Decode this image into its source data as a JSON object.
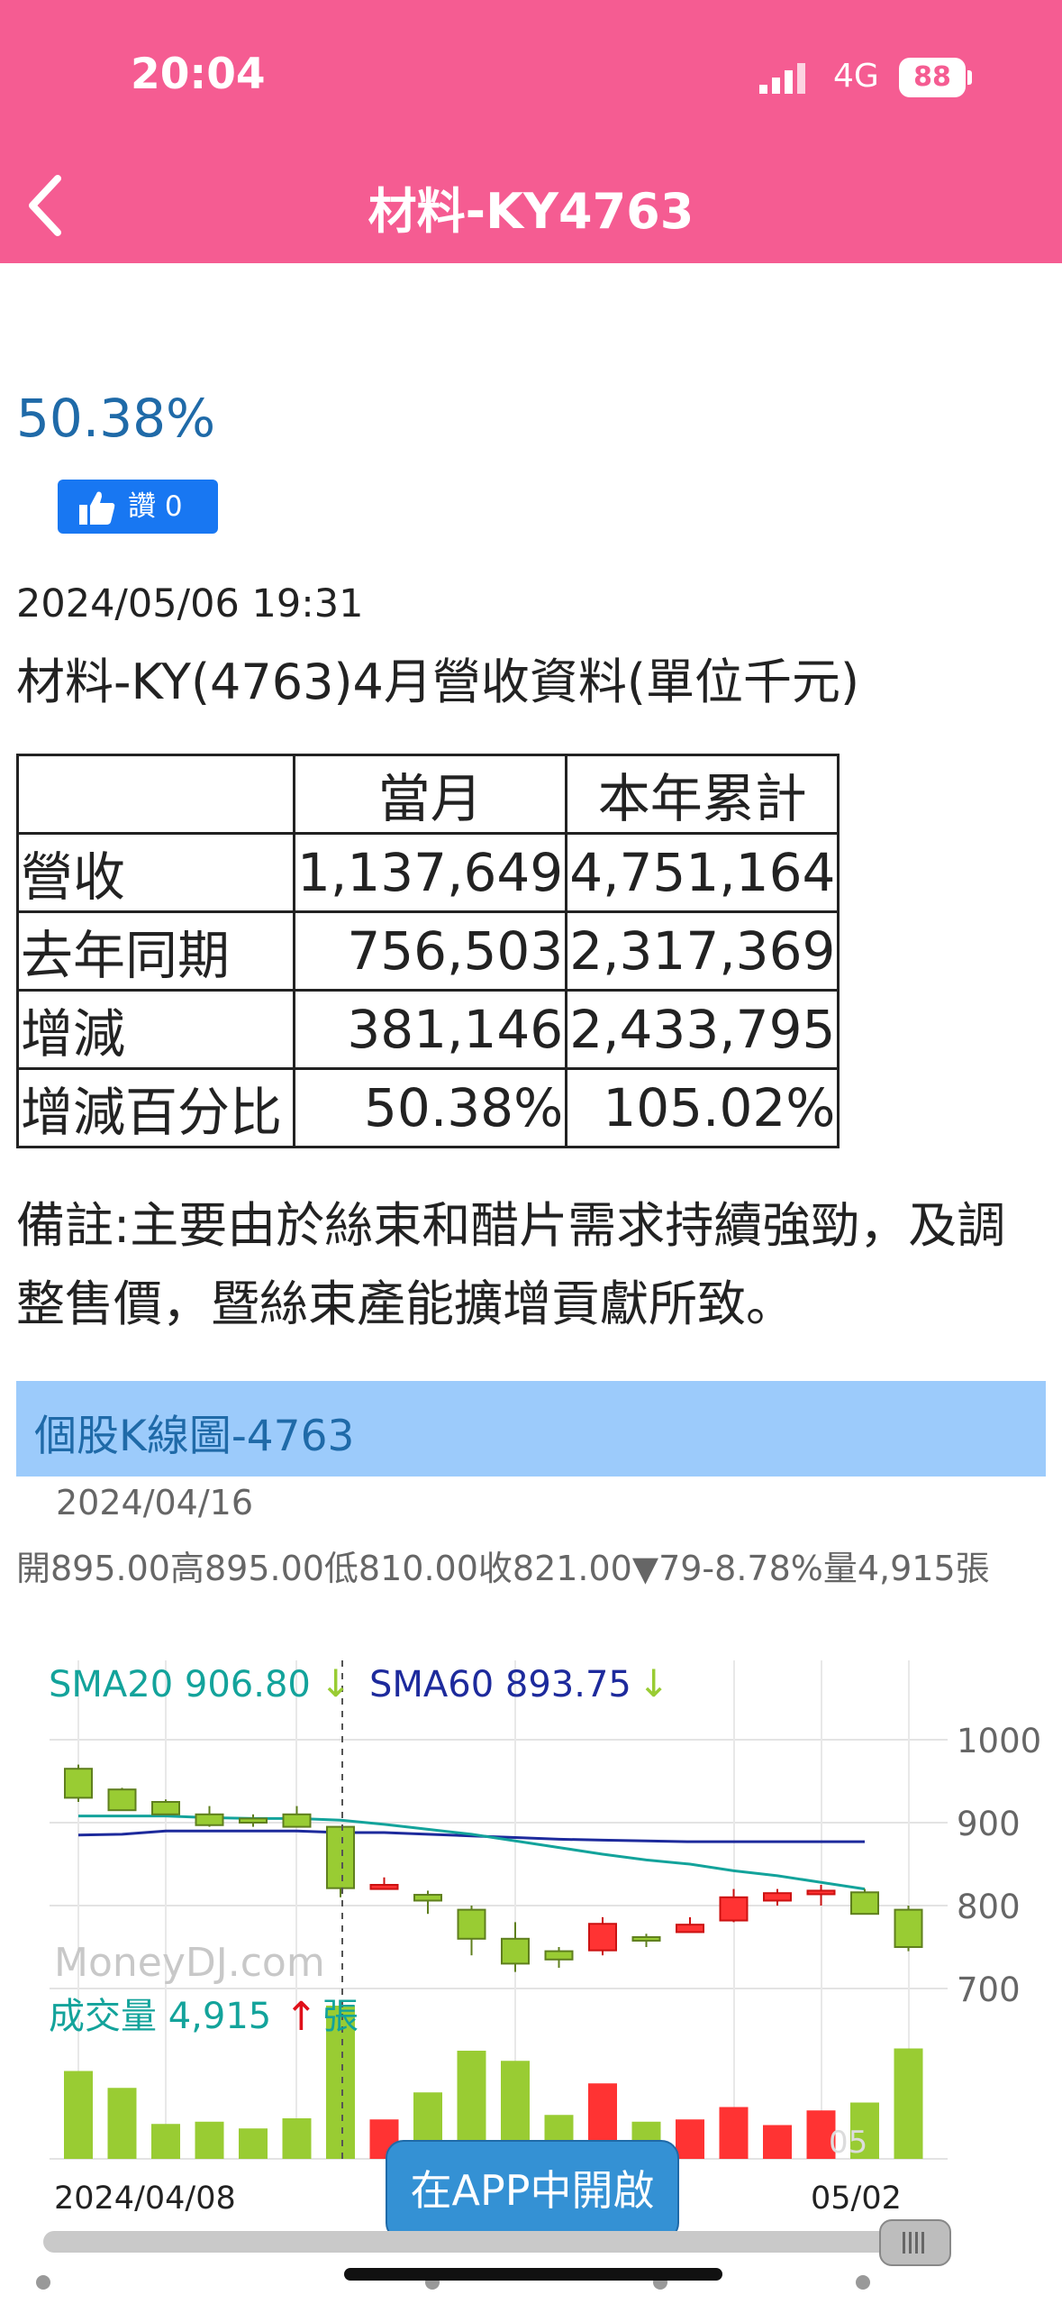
{
  "status": {
    "time": "20:04",
    "network": "4G",
    "battery": "88"
  },
  "header": {
    "title": "材料-KY4763"
  },
  "summary": {
    "percent": "50.38%",
    "like_label": "讚 0"
  },
  "article": {
    "datetime": "2024/05/06 19:31",
    "heading": "材料-KY(4763)4月營收資料(單位千元)",
    "table": {
      "columns": [
        "",
        "當月",
        "本年累計"
      ],
      "rows": [
        [
          "營收",
          "1,137,649",
          "4,751,164"
        ],
        [
          "去年同期",
          "756,503",
          "2,317,369"
        ],
        [
          "增減",
          "381,146",
          "2,433,795"
        ],
        [
          "增減百分比",
          "50.38%",
          "105.02%"
        ]
      ]
    },
    "note": "備註:主要由於絲束和醋片需求持續強勁，及調整售價，暨絲束產能擴增貢獻所致。"
  },
  "kchart": {
    "section_title": "個股K線圖-4763",
    "date": "2024/04/16",
    "ohlc_text": "開895.00高895.00低810.00收821.00▼79-8.78%量4,915張",
    "sma20_label": "SMA20 906.80",
    "sma60_label": "SMA60 893.75",
    "volume_label": "成交量 4,915",
    "volume_unit": "張",
    "watermark": "MoneyDJ.com",
    "x_start_label": "2024/04/08",
    "x_end_label": "05/02",
    "cursor_label": "05",
    "open_app_label": "在APP中開啟",
    "colors": {
      "up": "#ff3333",
      "down": "#99cc33",
      "sma20": "#13a39b",
      "sma60": "#1d2a9c"
    }
  },
  "chart_data": {
    "type": "candlestick",
    "y_ticks": [
      "1000",
      "900",
      "800",
      "700"
    ],
    "ylim": [
      700,
      1000
    ],
    "candles": [
      {
        "o": 965,
        "h": 970,
        "l": 925,
        "c": 930
      },
      {
        "o": 940,
        "h": 942,
        "l": 915,
        "c": 915
      },
      {
        "o": 925,
        "h": 928,
        "l": 910,
        "c": 910
      },
      {
        "o": 910,
        "h": 920,
        "l": 895,
        "c": 897
      },
      {
        "o": 905,
        "h": 910,
        "l": 895,
        "c": 900
      },
      {
        "o": 910,
        "h": 920,
        "l": 895,
        "c": 895
      },
      {
        "o": 895,
        "h": 895,
        "l": 810,
        "c": 821
      },
      {
        "o": 820,
        "h": 834,
        "l": 820,
        "c": 825
      },
      {
        "o": 813,
        "h": 818,
        "l": 790,
        "c": 806
      },
      {
        "o": 795,
        "h": 800,
        "l": 740,
        "c": 760
      },
      {
        "o": 760,
        "h": 780,
        "l": 720,
        "c": 730
      },
      {
        "o": 745,
        "h": 750,
        "l": 725,
        "c": 735
      },
      {
        "o": 746,
        "h": 786,
        "l": 740,
        "c": 778
      },
      {
        "o": 762,
        "h": 766,
        "l": 750,
        "c": 758
      },
      {
        "o": 768,
        "h": 786,
        "l": 768,
        "c": 777
      },
      {
        "o": 782,
        "h": 820,
        "l": 780,
        "c": 810
      },
      {
        "o": 806,
        "h": 820,
        "l": 800,
        "c": 815
      },
      {
        "o": 815,
        "h": 825,
        "l": 800,
        "c": 818
      },
      {
        "o": 816,
        "h": 820,
        "l": 790,
        "c": 790
      },
      {
        "o": 795,
        "h": 800,
        "l": 745,
        "c": 750
      }
    ],
    "sma20": [
      908,
      908,
      908,
      906,
      905,
      905,
      903,
      898,
      892,
      886,
      878,
      870,
      862,
      855,
      850,
      842,
      836,
      828,
      820
    ],
    "sma60": [
      885,
      886,
      890,
      890,
      890,
      890,
      888,
      888,
      886,
      884,
      882,
      880,
      879,
      878,
      877,
      877,
      877,
      877,
      877
    ],
    "volume": [
      7800,
      6300,
      3100,
      3300,
      2700,
      3600,
      13600,
      3500,
      5900,
      9600,
      8700,
      3900,
      6700,
      3300,
      3500,
      4600,
      3000,
      4300,
      5000,
      9800
    ]
  }
}
